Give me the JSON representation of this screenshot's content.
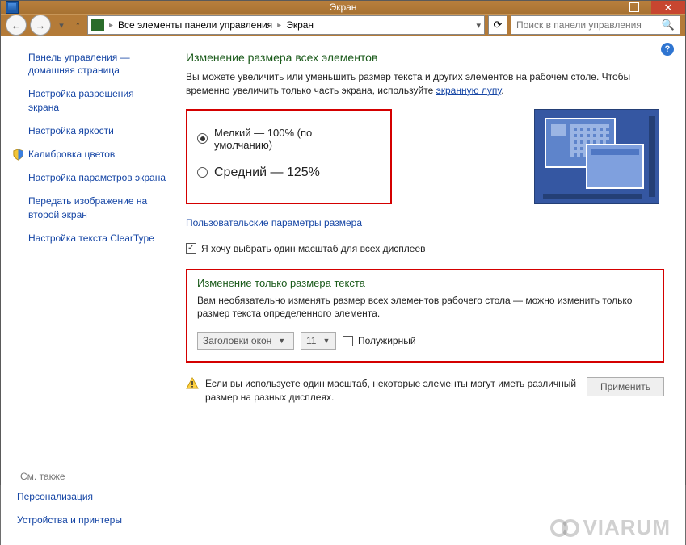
{
  "titlebar": {
    "title": "Экран"
  },
  "navbar": {
    "address_root": "Все элементы панели управления",
    "address_current": "Экран",
    "search_placeholder": "Поиск в панели управления"
  },
  "sidebar": {
    "items": [
      "Панель управления — домашняя страница",
      "Настройка разрешения экрана",
      "Настройка яркости",
      "Калибровка цветов",
      "Настройка параметров экрана",
      "Передать изображение на второй экран",
      "Настройка текста ClearType"
    ],
    "seealso_label": "См. также",
    "seealso_items": [
      "Персонализация",
      "Устройства и принтеры"
    ]
  },
  "main": {
    "heading": "Изменение размера всех элементов",
    "intro_prefix": "Вы можете увеличить или уменьшить размер текста и других элементов на рабочем столе. Чтобы временно увеличить только часть экрана, используйте ",
    "intro_link": "экранную лупу",
    "intro_suffix": ".",
    "radio_small": "Мелкий — 100% (по умолчанию)",
    "radio_medium": "Средний — 125%",
    "custom_link": "Пользовательские параметры размера",
    "chk_single_scale": "Я хочу выбрать один масштаб для всех дисплеев",
    "text_heading": "Изменение только размера текста",
    "text_intro": "Вам необязательно изменять размер всех элементов рабочего стола — можно изменить только размер текста определенного элемента.",
    "dropdown_element": "Заголовки окон",
    "dropdown_size": "11",
    "chk_bold": "Полужирный",
    "warning": "Если вы используете один масштаб, некоторые элементы могут иметь различный размер на разных дисплеях.",
    "apply_btn": "Применить"
  },
  "watermark": "VIARUM"
}
